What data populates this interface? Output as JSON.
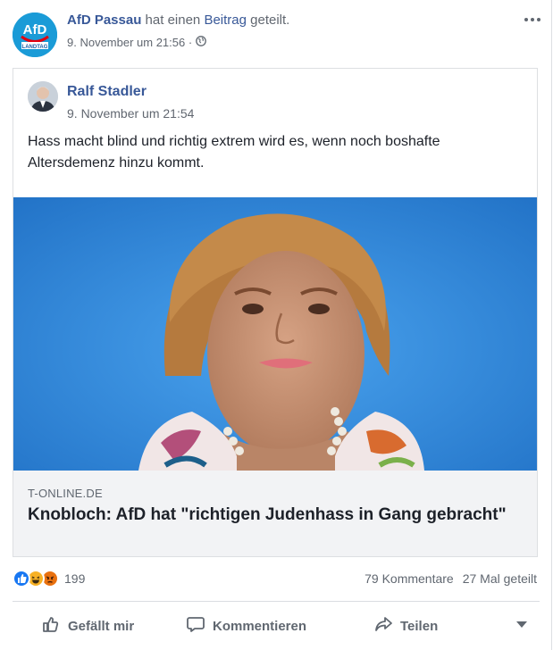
{
  "post": {
    "author": "AfD Passau",
    "action_text": "hat einen",
    "action_link": "Beitrag",
    "action_suffix": "geteilt.",
    "timestamp": "9. November um 21:56 ·",
    "avatar_logo_text": "AfD",
    "avatar_sub_text": "LANDTAG"
  },
  "shared": {
    "author": "Ralf Stadler",
    "timestamp": "9. November um 21:54",
    "text": "Hass macht blind und richtig extrem wird es, wenn noch boshafte Altersdemenz hinzu kommt."
  },
  "link_preview": {
    "domain": "T-ONLINE.DE",
    "title": "Knobloch: AfD hat \"richtigen Judenhass in Gang gebracht\""
  },
  "stats": {
    "reaction_count": "199",
    "comments": "79 Kommentare",
    "shares": "27 Mal geteilt"
  },
  "actions": {
    "like": "Gefällt mir",
    "comment": "Kommentieren",
    "share": "Teilen"
  },
  "colors": {
    "link": "#385898",
    "photo_background": "#2a86d9",
    "like_blue": "#1877f2",
    "haha_yellow": "#f7b125",
    "angry_orange": "#e9710f"
  },
  "icons": [
    "more-options-icon",
    "globe-icon",
    "like-reaction-icon",
    "haha-reaction-icon",
    "angry-reaction-icon",
    "thumbs-up-icon",
    "comment-icon",
    "share-icon",
    "chevron-down-icon"
  ]
}
